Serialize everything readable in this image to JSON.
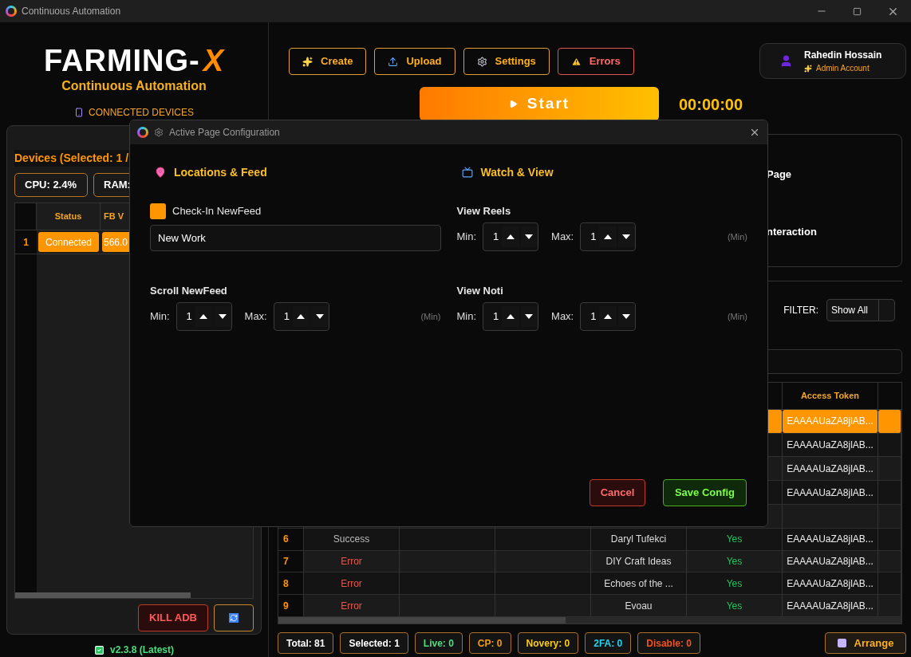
{
  "window": {
    "title": "Continuous Automation"
  },
  "logo": {
    "word": "FARMING-",
    "mark": "X",
    "tagline": "Continuous Automation"
  },
  "devices_panel": {
    "heading": "CONNECTED DEVICES",
    "title": "Devices (Selected: 1 /",
    "stats": [
      "CPU: 2.4%",
      "RAM:"
    ],
    "columns": [
      "Status",
      "FB V"
    ],
    "rows": [
      {
        "index": "1",
        "status": "Connected",
        "fb_version": "566.0",
        "selected": true
      }
    ],
    "kill_button": "KILL ADB"
  },
  "version": "v2.3.8 (Latest)",
  "toolbar": [
    {
      "label": "Create",
      "kind": "create"
    },
    {
      "label": "Upload",
      "kind": "upload"
    },
    {
      "label": "Settings",
      "kind": "settings"
    },
    {
      "label": "Errors",
      "kind": "errors"
    }
  ],
  "profile": {
    "name": "Rahedin Hossain",
    "role": "Admin Account"
  },
  "start": {
    "label": "Start",
    "timer": "00:00:00"
  },
  "options_card": {
    "items": [
      "Page",
      "nteraction"
    ]
  },
  "filter": {
    "label": "FILTER:",
    "value": "Show All"
  },
  "table": {
    "token_header": "Access Token",
    "rows": [
      {
        "token": "EAAAAUaZA8jlAB...",
        "selected": true
      },
      {
        "token": "EAAAAUaZA8jlAB...",
        "selected": false
      },
      {
        "token": "EAAAAUaZA8jlAB...",
        "selected": false
      },
      {
        "token": "EAAAAUaZA8jlAB...",
        "selected": false
      },
      {
        "selected": false
      },
      {
        "index": "6",
        "status": "Success",
        "kind": "success",
        "name": "Daryl Tufekci",
        "live": "Yes",
        "token": "EAAAAUaZA8jlAB...",
        "selected": false
      },
      {
        "index": "7",
        "status": "Error",
        "kind": "error",
        "name": "DIY Craft Ideas",
        "live": "Yes",
        "token": "EAAAAUaZA8jlAB...",
        "selected": false
      },
      {
        "index": "8",
        "status": "Error",
        "kind": "error",
        "name": "Echoes of the ...",
        "live": "Yes",
        "token": "EAAAAUaZA8jlAB...",
        "selected": false
      },
      {
        "index": "9",
        "status": "Error",
        "kind": "error",
        "name": "Evoau",
        "live": "Yes",
        "token": "EAAAAUaZA8jlAB...",
        "selected": false
      }
    ]
  },
  "counters": [
    {
      "label": "Total: 81",
      "color": "#ffffff"
    },
    {
      "label": "Selected: 1",
      "color": "#ffffff"
    },
    {
      "label": "Live: 0",
      "color": "#4ade80"
    },
    {
      "label": "CP: 0",
      "color": "#f59e0b"
    },
    {
      "label": "Novery: 0",
      "color": "#facc15"
    },
    {
      "label": "2FA: 0",
      "color": "#22d3ee"
    },
    {
      "label": "Disable: 0",
      "color": "#f4511e"
    }
  ],
  "arrange_button": "Arrange",
  "dialog": {
    "title": "Active Page Configuration",
    "sections": [
      {
        "title": "Locations & Feed",
        "checkbox": {
          "label": "Check-In NewFeed",
          "checked": true
        },
        "input": {
          "value": "New Work"
        },
        "ranges": [
          {
            "label": "Scroll NewFeed",
            "min_label": "Min:",
            "min": "1",
            "max_label": "Max:",
            "max": "1",
            "unit": "(Min)"
          }
        ]
      },
      {
        "title": "Watch & View",
        "ranges": [
          {
            "label": "View Reels",
            "min_label": "Min:",
            "min": "1",
            "max_label": "Max:",
            "max": "1",
            "unit": "(Min)"
          },
          {
            "label": "View Noti",
            "min_label": "Min:",
            "min": "1",
            "max_label": "Max:",
            "max": "1",
            "unit": "(Min)"
          }
        ]
      }
    ],
    "cancel": "Cancel",
    "save": "Save Config"
  }
}
